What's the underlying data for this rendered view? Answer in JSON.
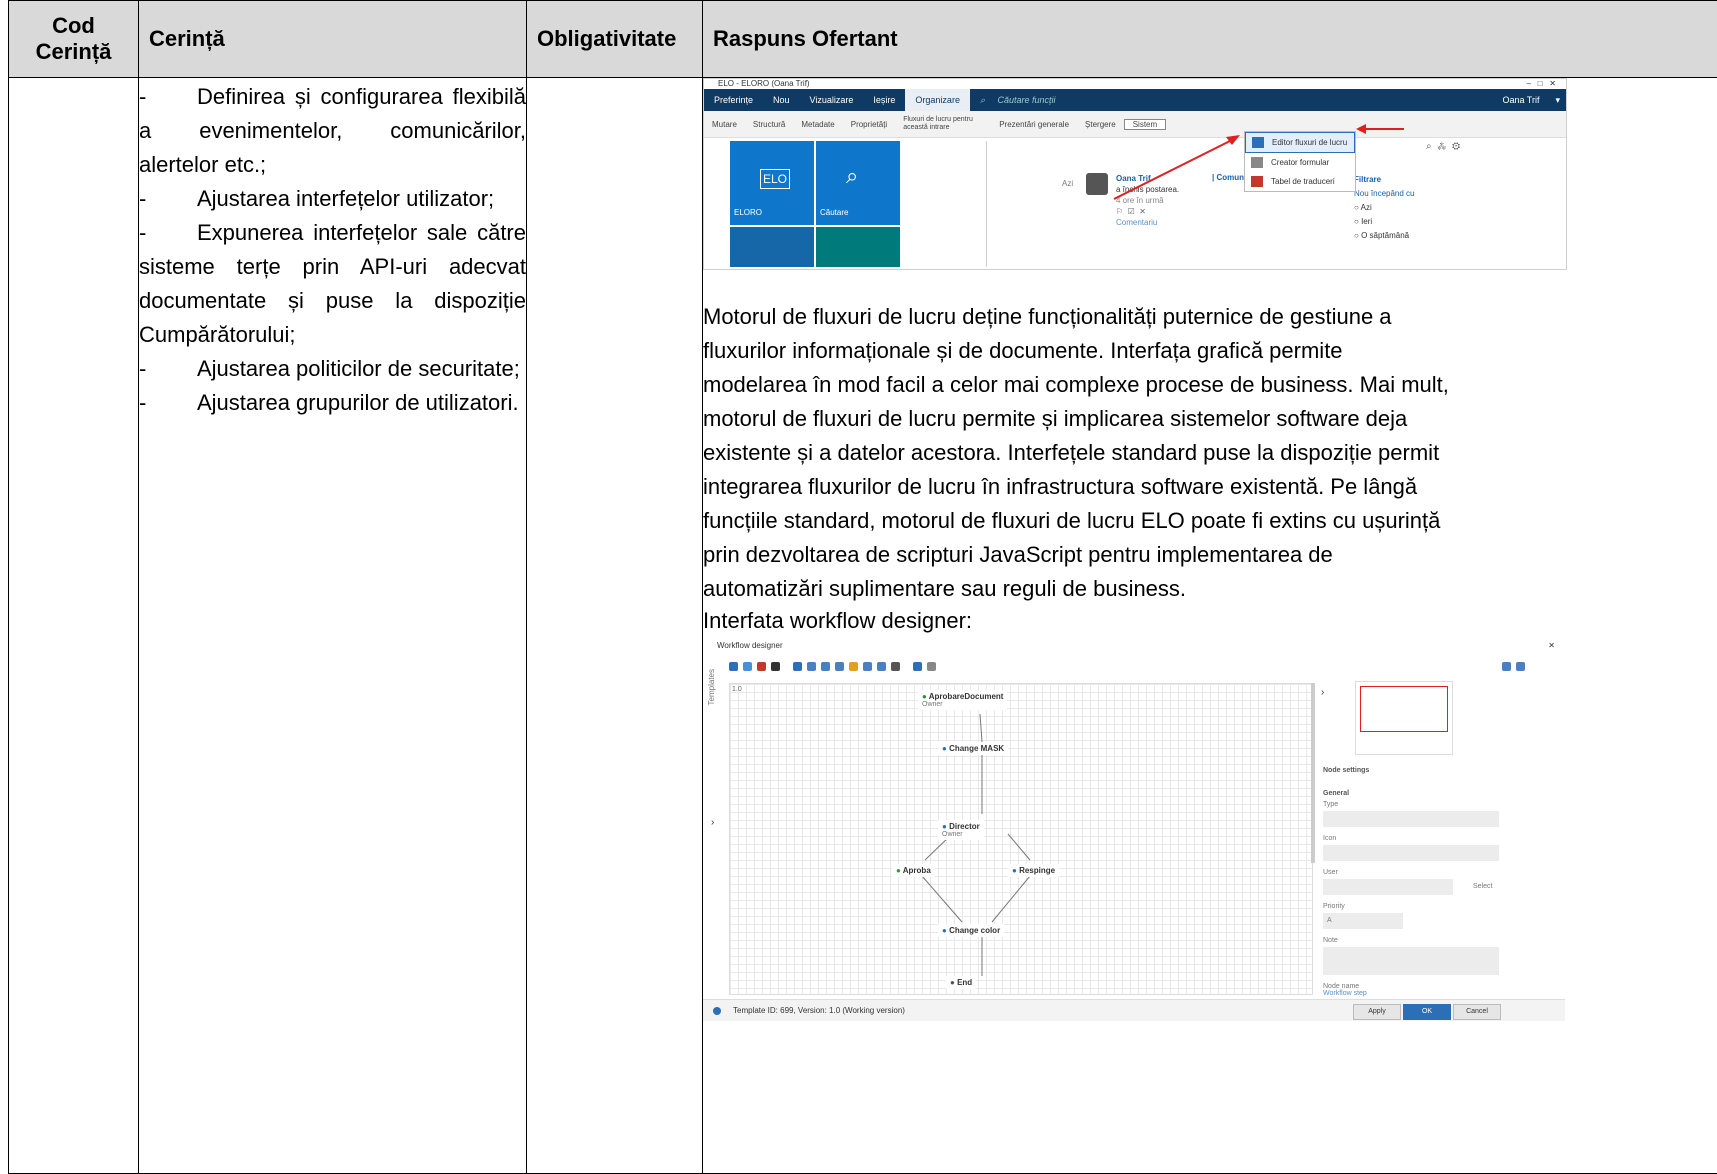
{
  "table": {
    "headers": [
      "Cod\nCerință",
      "Cerință",
      "Obligativitate",
      "Raspuns Ofertant"
    ],
    "requirements": [
      "Definirea și configurarea flexibilă a evenimentelor, comunicărilor, alertelor etc.;",
      "Ajustarea interfețelor utilizator;",
      "Expunerea interfețelor sale către sisteme terțe prin API-uri adecvat documentate și puse la dispoziție Cumpărătorului;",
      "Ajustarea politicilor de securitate;",
      "Ajustarea grupurilor de utilizatori."
    ],
    "dash": "-"
  },
  "elo": {
    "title": "ELO - ELORO (Oana Trif)",
    "menu": [
      "Preferințe",
      "Nou",
      "Vizualizare",
      "Ieșire",
      "Organizare",
      "Căutare funcții"
    ],
    "user": "Oana Trif",
    "ribbon": [
      "Mutare",
      "Structură",
      "Metadate",
      "Proprietăți",
      "Fluxuri de lucru pentru această intrare",
      "Prezentări generale",
      "Ștergere",
      "Sistem"
    ],
    "dropdown": [
      "Editor fluxuri de lucru",
      "Creator formular",
      "Tabel de traduceri"
    ],
    "tiles": [
      "ELORO",
      "Căutare"
    ],
    "feed": {
      "day": "Azi",
      "author": "Oana Trif",
      "action": "a închis postarea.",
      "time": "4 ore în urmă",
      "comment": "Comentariu",
      "tabs": "| Comunitate  Experți"
    },
    "filter": {
      "title": "Filtrare",
      "subtitle": "Nou începând cu",
      "options": [
        "Azi",
        "Ieri",
        "O săptămână"
      ]
    }
  },
  "paragraph": "Motorul de fluxuri de lucru deține funcționalități puternice de gestiune a fluxurilor informaționale și de documente. Interfața grafică permite modelarea în mod facil a celor mai complexe procese de business. Mai mult, motorul de fluxuri de lucru permite și implicarea sistemelor software deja existente și a datelor acestora. Interfețele standard puse la dispoziție permit integrarea fluxurilor de lucru în infrastructura software existentă. Pe lângă funcțiile standard, motorul de fluxuri de lucru ELO poate fi extins cu ușurință prin dezvoltarea de scripturi JavaScript pentru implementarea de automatizări suplimentare sau reguli de business.",
  "paragraph_lines": [
    "Motorul de fluxuri de lucru deține funcționalități puternice de gestiune a",
    "fluxurilor informaționale și de documente. Interfața grafică permite",
    "modelarea în mod facil a celor mai complexe procese de business. Mai mult,",
    "motorul de fluxuri de lucru permite și implicarea sistemelor software deja",
    "existente și a datelor acestora. Interfețele standard puse la dispoziție permit",
    "integrarea fluxurilor de lucru în infrastructura software existentă. Pe lângă",
    "funcțiile standard, motorul de fluxuri de lucru ELO poate fi extins cu ușurință",
    "prin dezvoltarea de scripturi JavaScript pentru implementarea de",
    "automatizări suplimentare sau reguli de business."
  ],
  "workflow_label": "Interfata workflow designer:",
  "workflow": {
    "title": "Workflow designer",
    "templates": "Templates",
    "version": "1.0",
    "nodes": [
      {
        "label": "AprobareDocument",
        "sub": "Owner"
      },
      {
        "label": "Change MASK",
        "sub": ""
      },
      {
        "label": "Director",
        "sub": "Owner"
      },
      {
        "label": "Aproba",
        "sub": ""
      },
      {
        "label": "Respinge",
        "sub": ""
      },
      {
        "label": "Change color",
        "sub": ""
      },
      {
        "label": "End",
        "sub": ""
      }
    ],
    "settings": {
      "title": "Node settings",
      "section": "General",
      "fields": [
        "Type",
        "Icon",
        "User",
        "Priority",
        "Note"
      ],
      "priority_value": "A",
      "select": "Select",
      "node_name": "Node name",
      "node_name_value": "Workflow step"
    },
    "status": "Template ID: 699, Version: 1.0 (Working version)",
    "buttons": [
      "Apply",
      "OK",
      "Cancel"
    ]
  },
  "colors": {
    "header_bg": "#d9d9d9",
    "elo_menu": "#0f3a64",
    "tile_blue": "#0e77cc",
    "tile_teal": "#007a7a",
    "arrow_red": "#e02020"
  }
}
